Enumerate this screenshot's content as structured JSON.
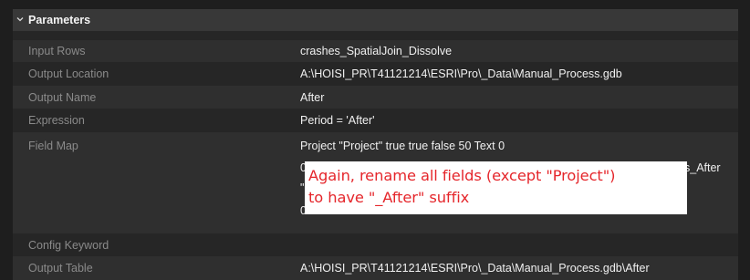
{
  "section": {
    "title": "Parameters",
    "icon": "chevron-down-icon"
  },
  "rows": [
    {
      "label": "Input Rows",
      "value": "crashes_SpatialJoin_Dissolve"
    },
    {
      "label": "Output Location",
      "value": "A:\\HOISI_PR\\T41121214\\ESRI\\Pro\\_Data\\Manual_Process.gdb"
    },
    {
      "label": "Output Name",
      "value": "After"
    },
    {
      "label": "Expression",
      "value": "Period = 'After'"
    },
    {
      "label": "Field Map",
      "value": "Project \"Project\" true true false 50 Text 0"
    },
    {
      "label": "Config Keyword",
      "value": ""
    },
    {
      "label": "Output Table",
      "value": "A:\\HOISI_PR\\T41121214\\ESRI\\Pro\\_Data\\Manual_Process.gdb\\After"
    }
  ],
  "field_map_partial": {
    "line2_start": "0",
    "line2_end": "s_After",
    "line3_start": "\"",
    "line4_start": "0"
  },
  "annotation": {
    "line1": "Again, rename all fields (except \"Project\")",
    "line2": "to have \"_After\" suffix",
    "text_color": "#e5262b"
  },
  "colors": {
    "background": "#1e1e1e",
    "header": "#383838",
    "row_alt": "#2f2f2f",
    "row_base": "#262626",
    "label_text": "#8a8a8a",
    "value_text": "#f0f0f0"
  }
}
